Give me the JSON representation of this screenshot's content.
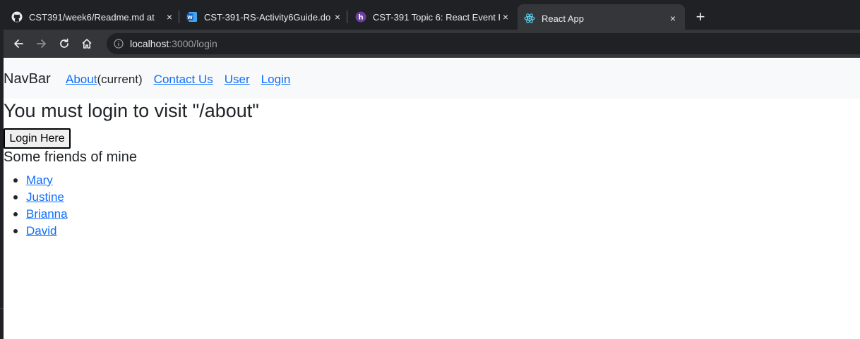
{
  "browser": {
    "tabs": [
      {
        "title": "CST391/week6/Readme.md at",
        "icon": "github-icon"
      },
      {
        "title": "CST-391-RS-Activity6Guide.do",
        "icon": "word-icon"
      },
      {
        "title": "CST-391 Topic 6: React Event H",
        "icon": "halo-icon"
      },
      {
        "title": "React App",
        "icon": "react-icon",
        "active": true
      }
    ],
    "close_glyph": "×",
    "new_tab_glyph": "+",
    "url_host": "localhost",
    "url_rest": ":3000/login"
  },
  "navbar": {
    "brand": "NavBar",
    "links": {
      "about": "About",
      "about_current": "(current)",
      "contact": "Contact Us",
      "user": "User",
      "login": "Login"
    }
  },
  "main": {
    "message": "You must login to visit \"/about\"",
    "login_button": "Login Here",
    "friends_title": "Some friends of mine",
    "friends": [
      "Mary",
      "Justine",
      "Brianna",
      "David"
    ]
  }
}
